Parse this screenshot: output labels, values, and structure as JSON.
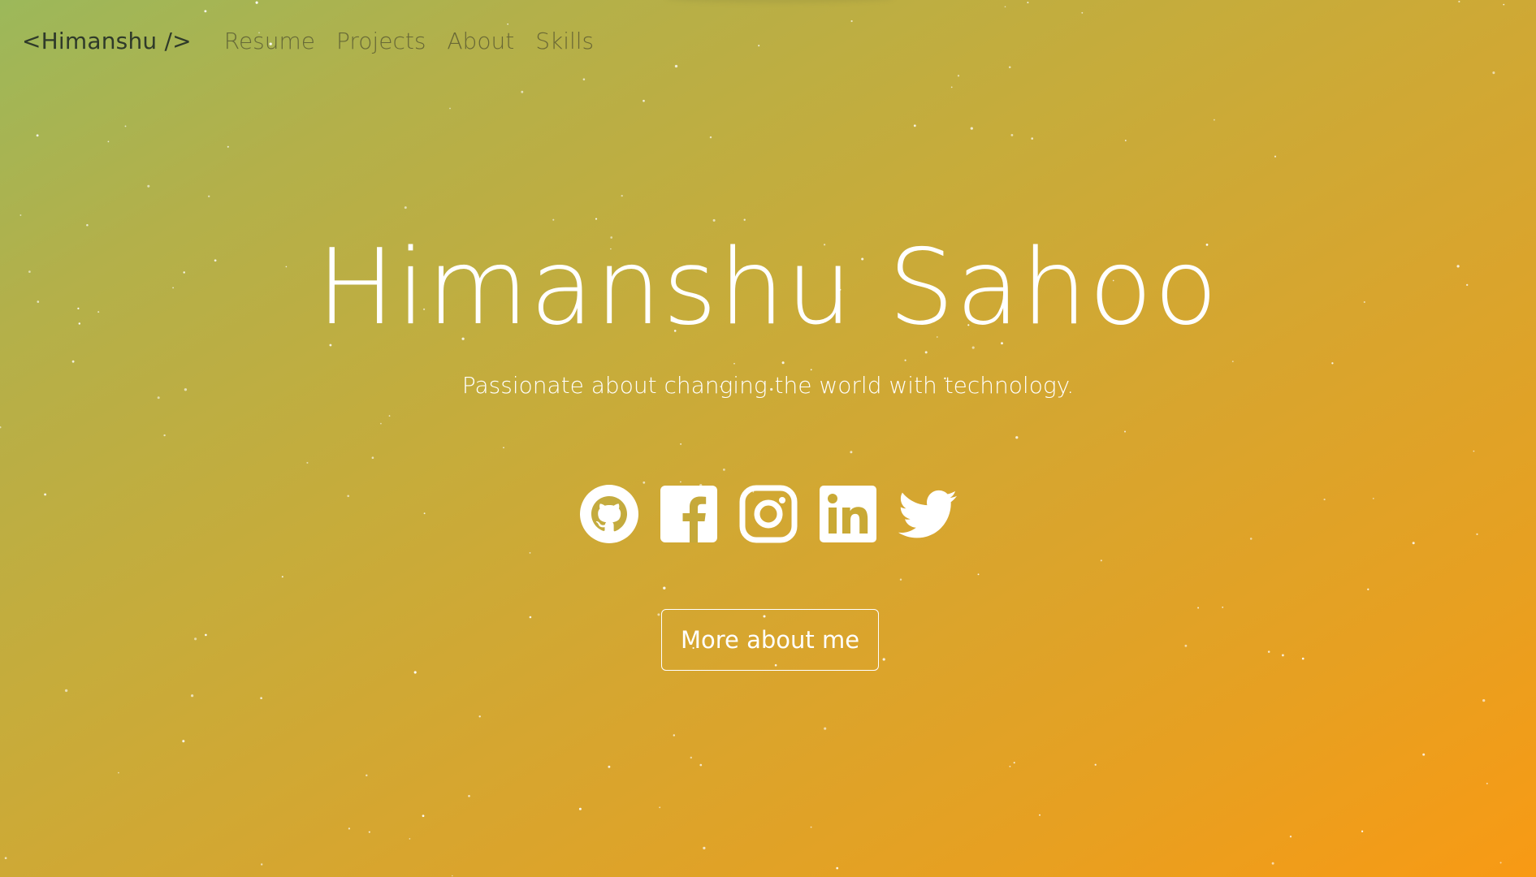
{
  "navbar": {
    "brand": "<Himanshu />",
    "links": [
      "Resume",
      "Projects",
      "About",
      "Skills"
    ]
  },
  "hero": {
    "title": "Himanshu Sahoo",
    "subtitle": "Passionate about changing the world with technology."
  },
  "social": {
    "icons": [
      "github-icon",
      "facebook-icon",
      "instagram-icon",
      "linkedin-icon",
      "twitter-icon"
    ]
  },
  "cta": {
    "label": "More about me"
  },
  "colors": {
    "gradient_start": "#9cb85a",
    "gradient_end": "#f89a14",
    "text": "#ffffff",
    "brand": "#2f3a2a"
  }
}
